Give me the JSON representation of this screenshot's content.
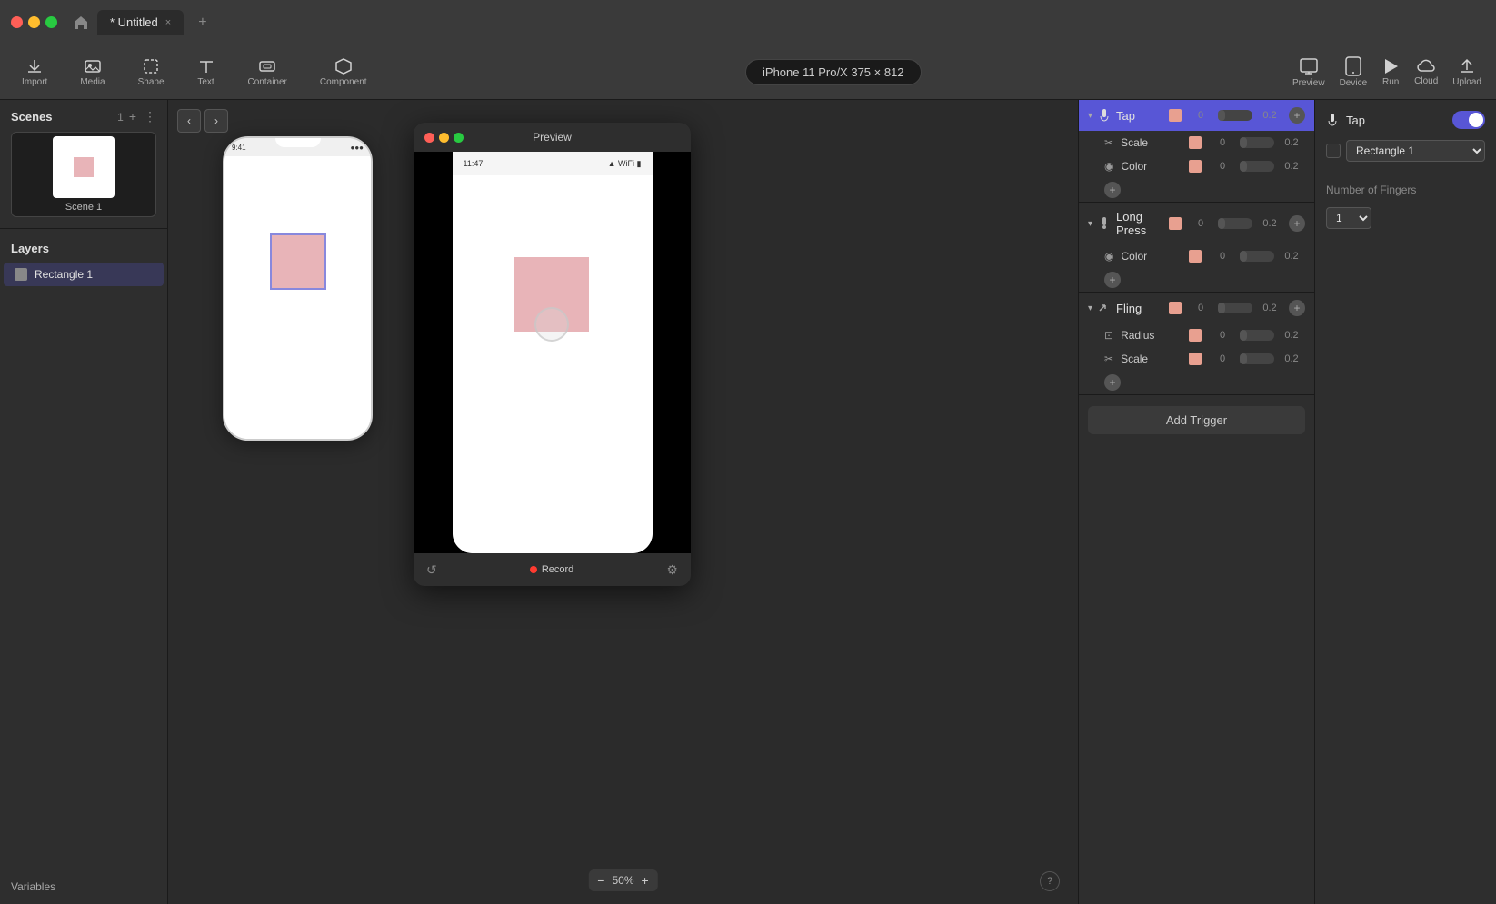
{
  "titlebar": {
    "tab_title": "* Untitled",
    "tab_close": "×",
    "add_tab": "+"
  },
  "toolbar": {
    "import_label": "Import",
    "media_label": "Media",
    "shape_label": "Shape",
    "text_label": "Text",
    "container_label": "Container",
    "component_label": "Component",
    "device_badge": "iPhone 11 Pro/X  375 × 812",
    "preview_label": "Preview",
    "device_label": "Device",
    "run_label": "Run",
    "cloud_label": "Cloud",
    "upload_label": "Upload"
  },
  "left_panel": {
    "scenes_title": "Scenes",
    "scenes_count": "1",
    "scene_name": "Scene 1",
    "layers_title": "Layers",
    "layer_name": "Rectangle 1",
    "variables_label": "Variables"
  },
  "canvas": {
    "scene_label": "Scene 1",
    "zoom_value": "50%",
    "nav_back": "‹",
    "nav_forward": "›",
    "help": "?"
  },
  "preview": {
    "title": "Preview",
    "time": "11:47",
    "record_label": "Record",
    "refresh_icon": "↺",
    "settings_icon": "⚙"
  },
  "triggers": {
    "tap": {
      "name": "Tap",
      "num1": "0",
      "num2": "0.2",
      "sub_items": [
        {
          "icon": "✂",
          "label": "Scale"
        },
        {
          "icon": "◉",
          "label": "Color"
        }
      ]
    },
    "long_press": {
      "name": "Long Press",
      "num1": "0",
      "num2": "0.2",
      "sub_items": [
        {
          "icon": "◉",
          "label": "Color"
        }
      ]
    },
    "fling": {
      "name": "Fling",
      "num1": "0",
      "num2": "0.2",
      "sub_items": [
        {
          "icon": "⊡",
          "label": "Radius"
        },
        {
          "icon": "✂",
          "label": "Scale"
        }
      ]
    },
    "add_trigger_label": "Add Trigger"
  },
  "properties": {
    "title": "Tap",
    "target_label": "Rectangle 1",
    "fingers_label": "Number of Fingers",
    "fingers_value": "1"
  },
  "colors": {
    "accent": "#5856d6",
    "rect_fill": "#e8b4b8",
    "swatch": "#e8a090",
    "dark_bg": "#2e2e2e",
    "toolbar_bg": "#3a3a3a"
  }
}
